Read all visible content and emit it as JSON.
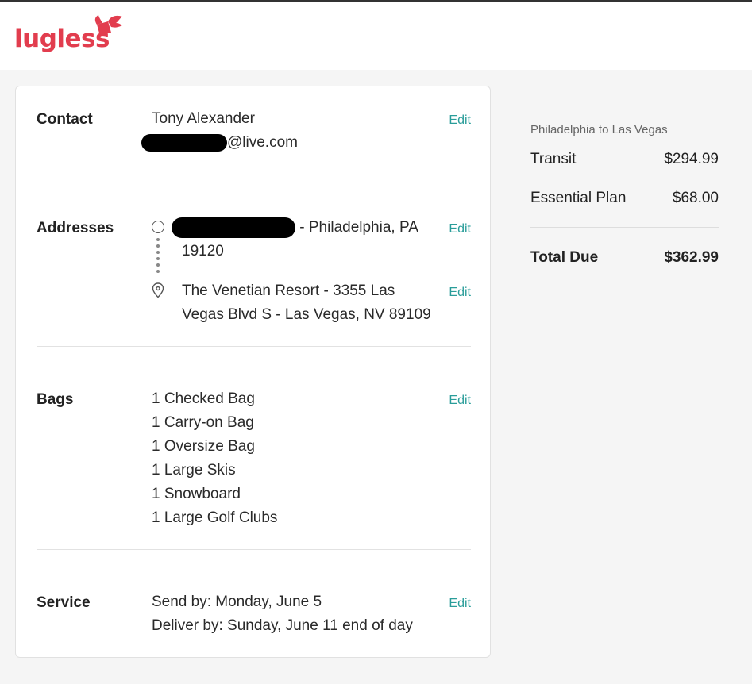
{
  "brand": {
    "name": "lugless",
    "color": "#e23d4e"
  },
  "accent": "#2a9d9a",
  "contact": {
    "label": "Contact",
    "name": "Tony Alexander",
    "email_suffix": "@live.com",
    "edit": "Edit"
  },
  "addresses": {
    "label": "Addresses",
    "origin_suffix": "- Philadelphia, PA",
    "origin_zip": "19120",
    "destination_line1": "The Venetian Resort - 3355 Las",
    "destination_line2": "Vegas Blvd S - Las Vegas, NV 89109",
    "edit_origin": "Edit",
    "edit_destination": "Edit"
  },
  "bags": {
    "label": "Bags",
    "items": [
      "1 Checked Bag",
      "1 Carry-on Bag",
      "1 Oversize Bag",
      "1 Large Skis",
      "1 Snowboard",
      "1 Large Golf Clubs"
    ],
    "edit": "Edit"
  },
  "service": {
    "label": "Service",
    "send_by": "Send by: Monday, June 5",
    "deliver_by": "Deliver by: Sunday, June 11 end of day",
    "edit": "Edit"
  },
  "summary": {
    "route": "Philadelphia to Las Vegas",
    "lines": [
      {
        "label": "Transit",
        "amount": "$294.99"
      },
      {
        "label": "Essential Plan",
        "amount": "$68.00"
      }
    ],
    "total_label": "Total Due",
    "total_amount": "$362.99"
  }
}
